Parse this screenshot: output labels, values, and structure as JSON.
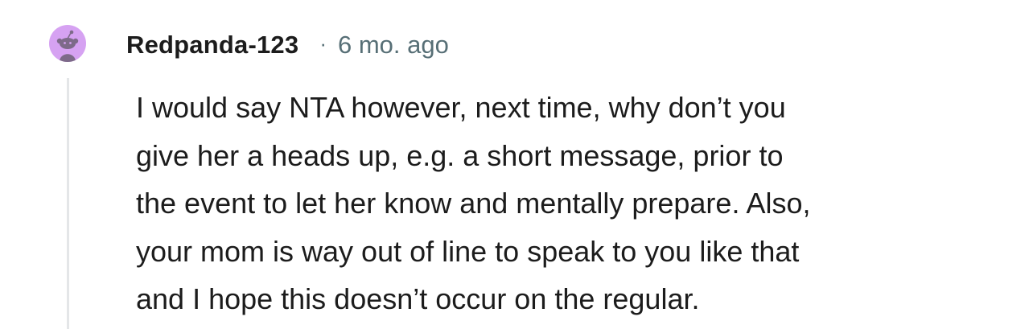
{
  "comment": {
    "author": "Redpanda-123",
    "separator": "·",
    "timestamp": "6 mo. ago",
    "avatar_icon": "snoo-avatar-icon",
    "avatar_color": "#d6a2f2",
    "body_lines": [
      "I would say NTA however, next time, why don’t you",
      "give her a heads up, e.g. a short message, prior to",
      "the event to let her know and mentally prepare. Also,",
      "your mom is way out of line to speak to you like that",
      "and I hope this doesn’t occur on the regular."
    ]
  }
}
